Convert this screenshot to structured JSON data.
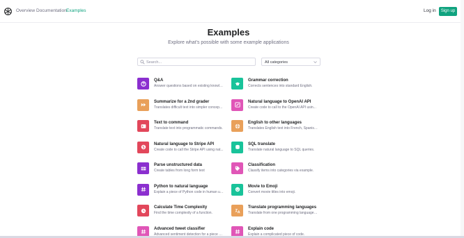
{
  "nav": {
    "links": [
      "Overview",
      "Documentation",
      "Examples"
    ],
    "login_label": "Log in",
    "signup_label": "Sign up"
  },
  "hero": {
    "title": "Examples",
    "subtitle": "Explore what's possible with some example applications"
  },
  "search": {
    "placeholder": "Search..."
  },
  "category_select": {
    "value": "All categories"
  },
  "colors": {
    "accent": "#10a37f",
    "purple": "#8b2fcf",
    "orange": "#e9a05a",
    "red": "#e2475b",
    "pink": "#e056b7",
    "green": "#19c39a"
  },
  "examples": [
    {
      "title": "Q&A",
      "desc": "Answer questions based on existing knowle...",
      "color": "#8b2fcf",
      "icon": "question-icon"
    },
    {
      "title": "Grammar correction",
      "desc": "Corrects sentences into standard English.",
      "color": "#19c39a",
      "icon": "graduation-icon"
    },
    {
      "title": "Summarize for a 2nd grader",
      "desc": "Translates difficult text into simpler concep...",
      "color": "#e9a05a",
      "icon": "fast-forward-icon"
    },
    {
      "title": "Natural language to OpenAI API",
      "desc": "Create code to call to the OpenAI API usin...",
      "color": "#e056b7",
      "icon": "edit-icon"
    },
    {
      "title": "Text to command",
      "desc": "Translate text into programmatic commands.",
      "color": "#e2475b",
      "icon": "terminal-icon"
    },
    {
      "title": "English to other languages",
      "desc": "Translates English text into French, Spanish...",
      "color": "#e9a05a",
      "icon": "globe-icon"
    },
    {
      "title": "Natural language to Stripe API",
      "desc": "Create code to call the Stripe API using nat...",
      "color": "#e2475b",
      "icon": "stripe-icon"
    },
    {
      "title": "SQL translate",
      "desc": "Translate natural language to SQL queries.",
      "color": "#19c39a",
      "icon": "database-icon"
    },
    {
      "title": "Parse unstructured data",
      "desc": "Create tables from long form text",
      "color": "#8b2fcf",
      "icon": "table-icon"
    },
    {
      "title": "Classification",
      "desc": "Classify items into categories via example.",
      "color": "#e056b7",
      "icon": "tag-icon"
    },
    {
      "title": "Python to natural language",
      "desc": "Explain a piece of Python code in human un...",
      "color": "#8b2fcf",
      "icon": "hash-icon"
    },
    {
      "title": "Movie to Emoji",
      "desc": "Convert movie titles into emoji.",
      "color": "#19c39a",
      "icon": "smile-icon"
    },
    {
      "title": "Calculate Time Complexity",
      "desc": "Find the time complexity of a function.",
      "color": "#e2475b",
      "icon": "clock-icon"
    },
    {
      "title": "Translate programming languages",
      "desc": "Translate from one programming language ...",
      "color": "#e9a05a",
      "icon": "translate-icon"
    },
    {
      "title": "Advanced tweet classifier",
      "desc": "Advanced sentiment detection for a piece o...",
      "color": "#e056b7",
      "icon": "hash-icon"
    },
    {
      "title": "Explain code",
      "desc": "Explain a complicated piece of code.",
      "color": "#e056b7",
      "icon": "hash-icon"
    }
  ]
}
